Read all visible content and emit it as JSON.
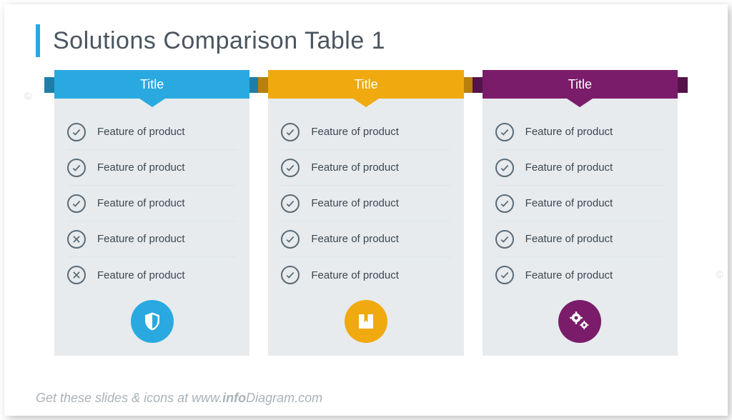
{
  "slide_title": "Solutions Comparison Table 1",
  "watermark": "©",
  "footer": {
    "prefix": "Get these slides & icons at www.",
    "brand_bold": "info",
    "brand_rest": "Diagram",
    "suffix": ".com"
  },
  "columns": [
    {
      "title": "Title",
      "color": "#2aa9e0",
      "ear_color": "#1f7ea8",
      "icon": "shield",
      "features": [
        {
          "status": "check",
          "label": "Feature of product"
        },
        {
          "status": "check",
          "label": "Feature of product"
        },
        {
          "status": "check",
          "label": "Feature of product"
        },
        {
          "status": "cross",
          "label": "Feature of product"
        },
        {
          "status": "cross",
          "label": "Feature of product"
        }
      ]
    },
    {
      "title": "Title",
      "color": "#f0a90f",
      "ear_color": "#b87f0a",
      "icon": "box",
      "features": [
        {
          "status": "check",
          "label": "Feature of product"
        },
        {
          "status": "check",
          "label": "Feature of product"
        },
        {
          "status": "check",
          "label": "Feature of product"
        },
        {
          "status": "check",
          "label": "Feature of product"
        },
        {
          "status": "check",
          "label": "Feature of product"
        }
      ]
    },
    {
      "title": "Title",
      "color": "#7a1c6a",
      "ear_color": "#55134a",
      "icon": "gears",
      "features": [
        {
          "status": "check",
          "label": "Feature of product"
        },
        {
          "status": "check",
          "label": "Feature of product"
        },
        {
          "status": "check",
          "label": "Feature of product"
        },
        {
          "status": "check",
          "label": "Feature of product"
        },
        {
          "status": "check",
          "label": "Feature of product"
        }
      ]
    }
  ]
}
